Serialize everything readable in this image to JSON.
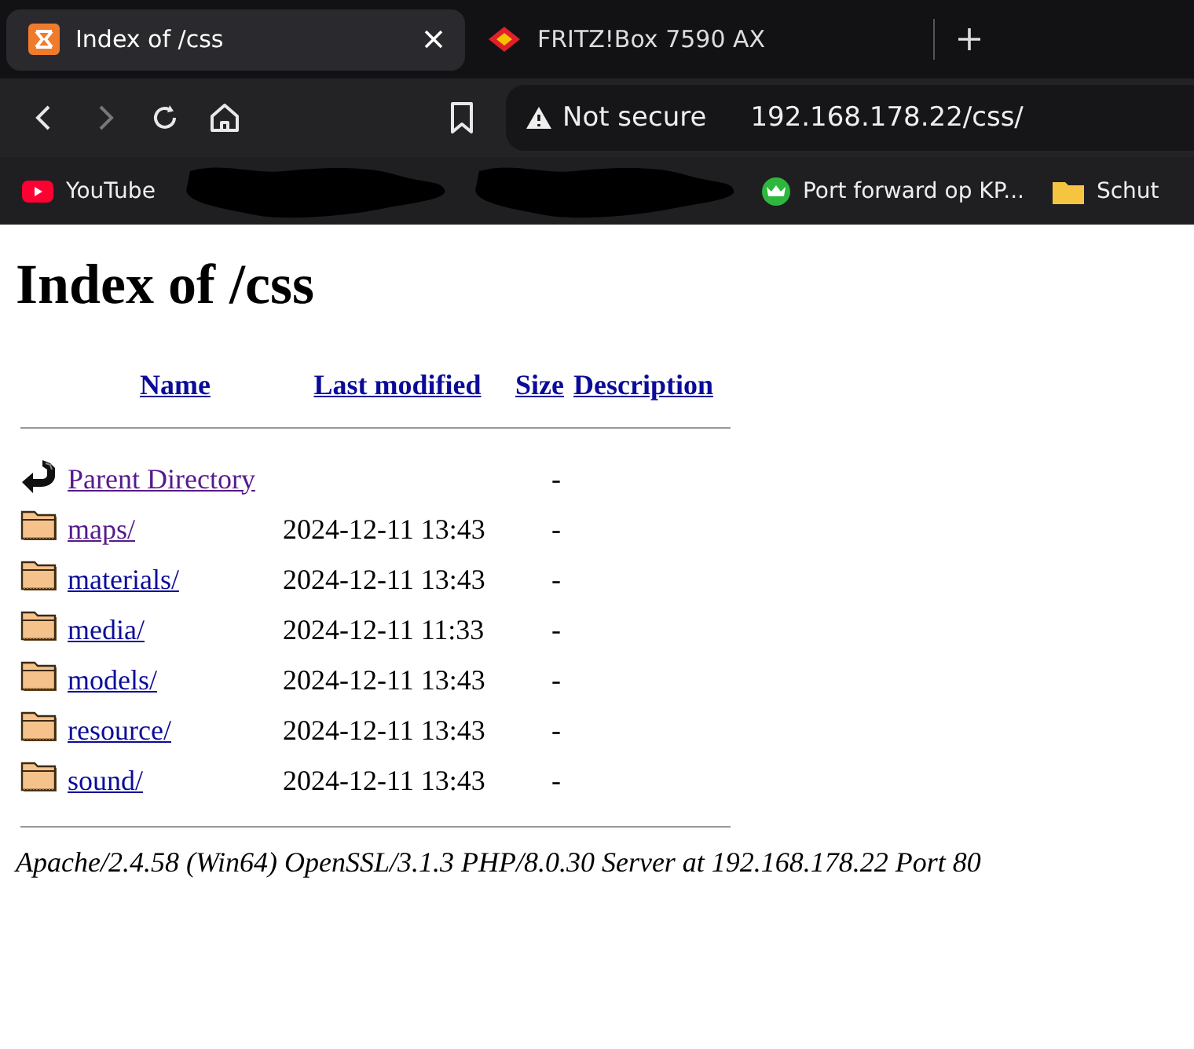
{
  "tabs": [
    {
      "title": "Index of /css",
      "selected": true,
      "kind": "xampp"
    },
    {
      "title": "FRITZ!Box 7590 AX",
      "selected": false,
      "kind": "fritz"
    }
  ],
  "toolbar": {
    "nav_buttons": [
      {
        "kind": "back",
        "disabled": false
      },
      {
        "kind": "forward",
        "disabled": true
      },
      {
        "kind": "reload",
        "disabled": false
      },
      {
        "kind": "home",
        "disabled": false
      }
    ],
    "security": "Not secure",
    "url": "192.168.178.22/css/"
  },
  "bookmarks": [
    {
      "kind": "youtube",
      "label": "YouTube"
    },
    {
      "kind": "redacted"
    },
    {
      "kind": "redacted"
    },
    {
      "kind": "crown",
      "label": "Port forward op KP..."
    },
    {
      "kind": "folder",
      "label": "Schut"
    }
  ],
  "page": {
    "heading": "Index of /css",
    "columns": [
      "Name",
      "Last modified",
      "Size",
      "Description"
    ],
    "rows": [
      {
        "kind": "parent",
        "name": "Parent Directory",
        "modified": "",
        "size": "-",
        "visited": true
      },
      {
        "kind": "dir",
        "name": "maps/",
        "modified": "2024-12-11 13:43",
        "size": "-",
        "visited": true
      },
      {
        "kind": "dir",
        "name": "materials/",
        "modified": "2024-12-11 13:43",
        "size": "-",
        "visited": false
      },
      {
        "kind": "dir",
        "name": "media/",
        "modified": "2024-12-11 11:33",
        "size": "-",
        "visited": false
      },
      {
        "kind": "dir",
        "name": "models/",
        "modified": "2024-12-11 13:43",
        "size": "-",
        "visited": false
      },
      {
        "kind": "dir",
        "name": "resource/",
        "modified": "2024-12-11 13:43",
        "size": "-",
        "visited": false
      },
      {
        "kind": "dir",
        "name": "sound/",
        "modified": "2024-12-11 13:43",
        "size": "-",
        "visited": false
      }
    ],
    "footer": "Apache/2.4.58 (Win64) OpenSSL/3.1.3 PHP/8.0.30 Server at 192.168.178.22 Port 80"
  }
}
